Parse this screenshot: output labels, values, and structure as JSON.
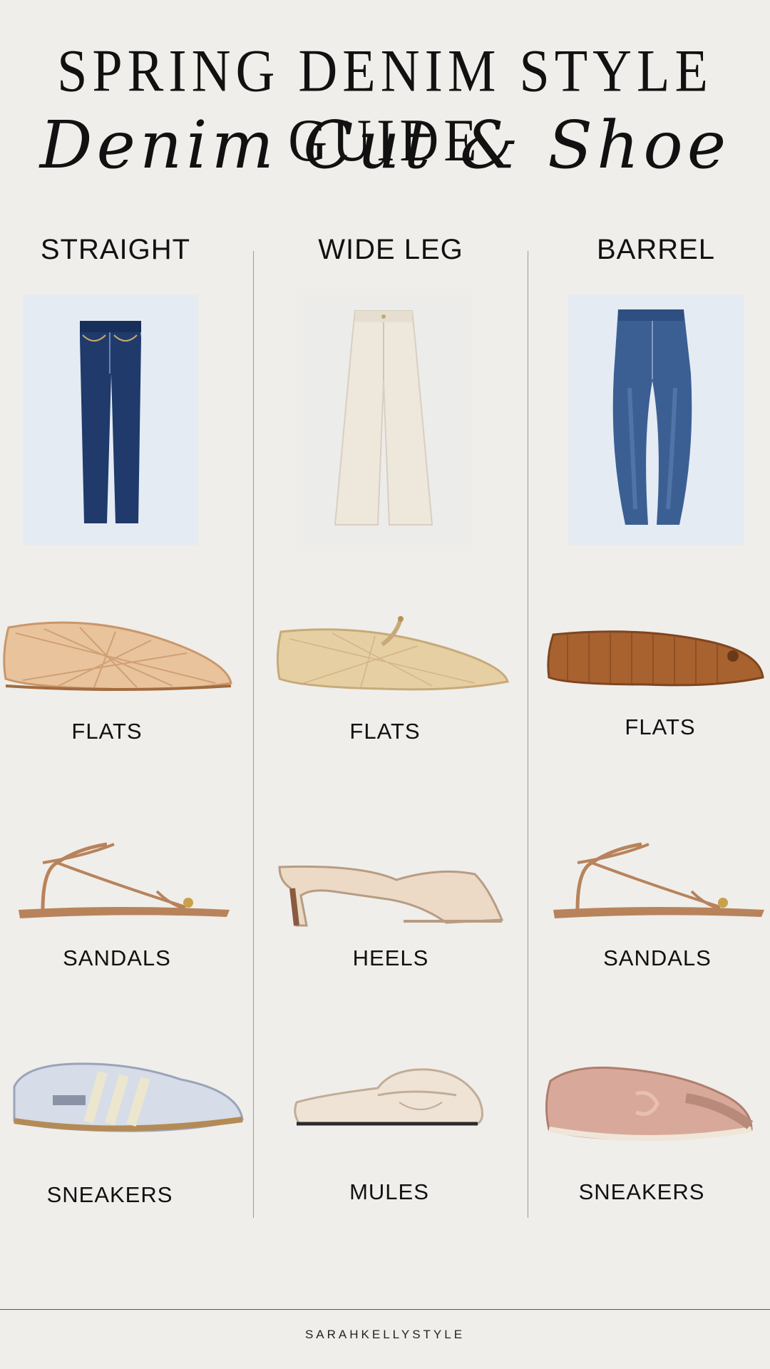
{
  "header": {
    "title": "SPRING DENIM STYLE GUIDE",
    "subtitle": "Denim Cut & Shoe"
  },
  "columns": [
    {
      "cut": "STRAIGHT",
      "jeans_color": "dark indigo denim",
      "shoes": [
        {
          "label": "FLATS",
          "icon": "mesh-flat"
        },
        {
          "label": "SANDALS",
          "icon": "strappy-sandal"
        },
        {
          "label": "SNEAKERS",
          "icon": "retro-sneaker"
        }
      ]
    },
    {
      "cut": "WIDE LEG",
      "jeans_color": "ecru",
      "shoes": [
        {
          "label": "FLATS",
          "icon": "mesh-mary-jane"
        },
        {
          "label": "HEELS",
          "icon": "kitten-heel-mule"
        },
        {
          "label": "MULES",
          "icon": "loafer-mule"
        }
      ]
    },
    {
      "cut": "BARREL",
      "jeans_color": "mid blue denim",
      "shoes": [
        {
          "label": "FLATS",
          "icon": "woven-ballet-flat"
        },
        {
          "label": "SANDALS",
          "icon": "strappy-sandal"
        },
        {
          "label": "SNEAKERS",
          "icon": "satin-sneaker"
        }
      ]
    }
  ],
  "footer": {
    "brand": "SARAHKELLYSTYLE"
  },
  "colors": {
    "background": "#efeeeb",
    "text": "#111111",
    "dark_denim": "#1f3a6b",
    "mid_denim": "#3b5f93",
    "ecru": "#eee8dc",
    "tan": "#c48a5a",
    "cognac": "#a8622f",
    "blush": "#d8a99a"
  }
}
